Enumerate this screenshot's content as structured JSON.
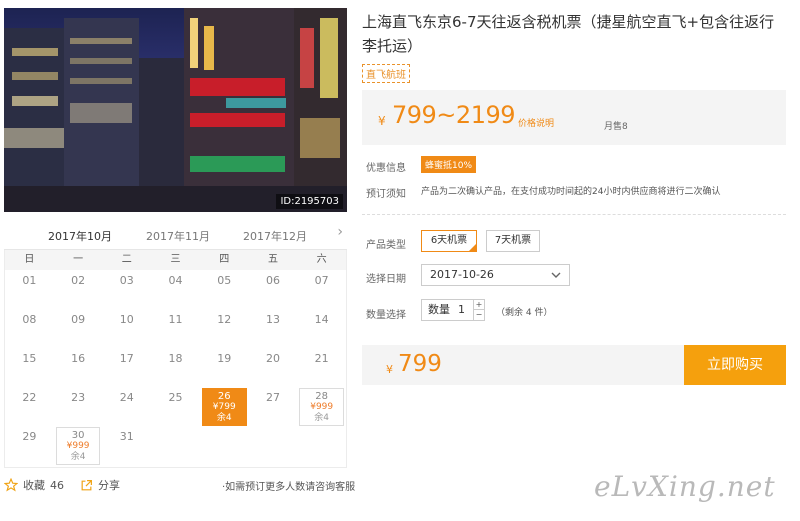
{
  "photo": {
    "id_label": "ID:2195703"
  },
  "calendar": {
    "months": [
      "2017年10月",
      "2017年11月",
      "2017年12月"
    ],
    "active_month": 0,
    "next_arrow": "›",
    "weekdays": [
      "日",
      "一",
      "二",
      "三",
      "四",
      "五",
      "六"
    ],
    "rows": [
      [
        {
          "d": "01"
        },
        {
          "d": "02"
        },
        {
          "d": "03"
        },
        {
          "d": "04"
        },
        {
          "d": "05"
        },
        {
          "d": "06"
        },
        {
          "d": "07"
        }
      ],
      [
        {
          "d": "08"
        },
        {
          "d": "09"
        },
        {
          "d": "10"
        },
        {
          "d": "11"
        },
        {
          "d": "12"
        },
        {
          "d": "13"
        },
        {
          "d": "14"
        }
      ],
      [
        {
          "d": "15"
        },
        {
          "d": "16"
        },
        {
          "d": "17"
        },
        {
          "d": "18"
        },
        {
          "d": "19"
        },
        {
          "d": "20"
        },
        {
          "d": "21"
        }
      ],
      [
        {
          "d": "22"
        },
        {
          "d": "23"
        },
        {
          "d": "24"
        },
        {
          "d": "25"
        },
        {
          "d": "26",
          "price": "¥799",
          "stock": "余4",
          "selected": true
        },
        {
          "d": "27"
        },
        {
          "d": "28",
          "price": "¥999",
          "stock": "余4"
        }
      ],
      [
        {
          "d": "29"
        },
        {
          "d": "30",
          "price": "¥999",
          "stock": "余4"
        },
        {
          "d": "31"
        },
        {
          "d": ""
        },
        {
          "d": ""
        },
        {
          "d": ""
        },
        {
          "d": ""
        }
      ]
    ]
  },
  "footer": {
    "fav_label": "收藏",
    "fav_count": "46",
    "share_label": "分享",
    "note": "·如需预订更多人数请咨询客服"
  },
  "product": {
    "title": "上海直飞东京6-7天往返含税机票（捷星航空直飞+包含往返行李托运）",
    "tag": "直飞航班",
    "currency": "¥",
    "price_range": "799~2199",
    "price_explain": "价格说明",
    "sold": "月售8",
    "promo_label": "优惠信息",
    "promo_badge": "蜂蜜抵10%",
    "notice_label": "预订须知",
    "notice_text": "产品为二次确认产品，在支付成功时间起的24小时内供应商将进行二次确认",
    "type_label": "产品类型",
    "type_options": [
      "6天机票",
      "7天机票"
    ],
    "date_label": "选择日期",
    "date_value": "2017-10-26",
    "qty_label": "数量选择",
    "qty_field_label": "数量",
    "qty_value": "1",
    "qty_plus": "+",
    "qty_minus": "−",
    "remain_text": "（剩余 4 件）",
    "final_price": "799",
    "buy_label": "立即购买"
  },
  "watermark": "eLvXing.net",
  "colors": {
    "accent": "#f08a16",
    "buy": "#f5a00d"
  }
}
